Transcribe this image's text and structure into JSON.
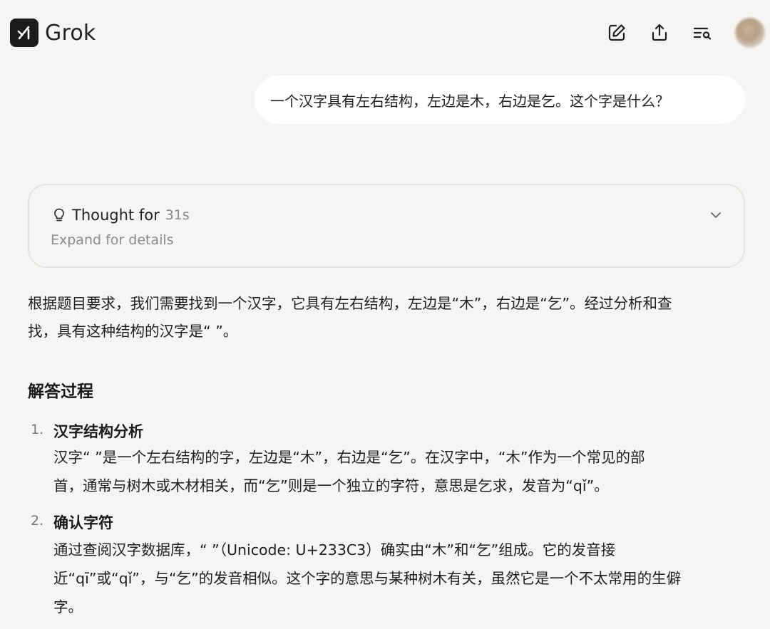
{
  "header": {
    "app_name": "Grok",
    "actions": [
      {
        "icon": "new-chat-icon"
      },
      {
        "icon": "share-icon"
      },
      {
        "icon": "history-search-icon"
      }
    ]
  },
  "user_message": "一个汉字具有左右结构，左边是木，右边是乞。这个字是什么？",
  "thought": {
    "label": "Thought for",
    "duration": "31s",
    "subtitle": "Expand for details"
  },
  "answer": {
    "intro_line1": "根据题目要求，我们需要找到一个汉字，它具有左右结构，左边是“木”，右边是“乞”。经过分析和查",
    "intro_line2": "找，具有这种结构的汉字是“  ”。",
    "section_title": "解答过程",
    "steps": [
      {
        "num": "1.",
        "title": "汉字结构分析",
        "lines": [
          "汉字“  ”是一个左右结构的字，左边是“木”，右边是“乞”。在汉字中，“木”作为一个常见的部",
          "首，通常与树木或木材相关，而“乞”则是一个独立的字符，意思是乞求，发音为“qǐ”。"
        ]
      },
      {
        "num": "2.",
        "title": "确认字符",
        "lines": [
          "通过查阅汉字数据库，“  ”（Unicode: U+233C3）确实由“木”和“乞”组成。它的发音接",
          "近“qī”或“qǐ”，与“乞”的发音相似。这个字的意思与某种树木有关，虽然它是一个不太常用的生僻",
          "字。"
        ]
      }
    ]
  }
}
